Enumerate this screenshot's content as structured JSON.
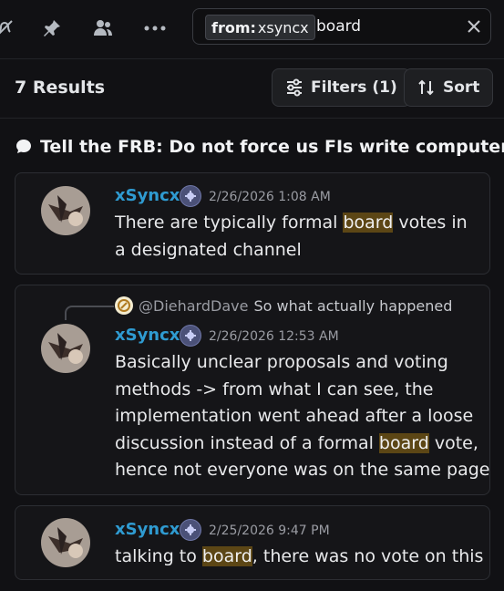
{
  "search": {
    "filter_key": "from:",
    "filter_value": "xsyncx",
    "query": "board"
  },
  "results": {
    "count_label": "7 Results",
    "filters_label": "Filters (1)",
    "sort_label": "Sort"
  },
  "channel": {
    "name": "Tell the FRB: Do not force us FIs write computer programs"
  },
  "messages": [
    {
      "author": "xSyncx",
      "timestamp": "2/26/2026 1:08 AM",
      "lines": [
        {
          "before": "There are typically formal ",
          "highlight": "board",
          "after": " votes in"
        },
        {
          "before": "a designated channel",
          "highlight": "",
          "after": ""
        }
      ]
    },
    {
      "reply_to_user": "@DiehardDave",
      "reply_to_text": "So what actually happened",
      "author": "xSyncx",
      "timestamp": "2/26/2026 12:53 AM",
      "lines": [
        {
          "before": "Basically unclear proposals and voting",
          "highlight": "",
          "after": ""
        },
        {
          "before": "methods -> from what I can see, the",
          "highlight": "",
          "after": ""
        },
        {
          "before": "implementation went ahead after a loose",
          "highlight": "",
          "after": ""
        },
        {
          "before": "discussion instead of a formal ",
          "highlight": "board",
          "after": " vote,"
        },
        {
          "before": "hence not everyone was on the same page",
          "highlight": "",
          "after": ""
        }
      ]
    },
    {
      "author": "xSyncx",
      "timestamp": "2/25/2026 9:47 PM",
      "lines": [
        {
          "before": "talking to ",
          "highlight": "board",
          "after": ", there was no vote on this"
        }
      ]
    }
  ],
  "colors": {
    "accent_name": "#2f9bd1",
    "highlight_bg": "#5c4615",
    "background": "#111114"
  },
  "icons": [
    "slash-bell-icon",
    "pin-icon",
    "members-icon",
    "more-icon",
    "close-icon",
    "filter-sliders-icon",
    "sort-arrows-icon",
    "thread-bubble-icon",
    "badge-icon"
  ]
}
